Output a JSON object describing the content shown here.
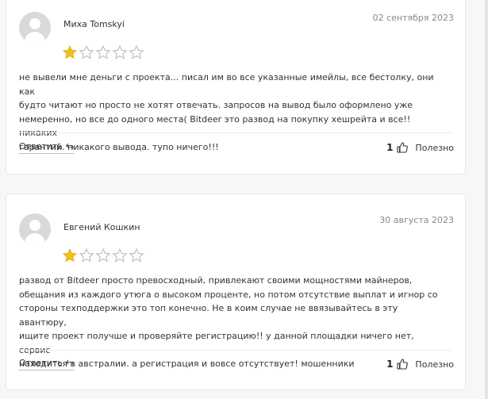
{
  "reviews": [
    {
      "author": "Миха Tomskyi",
      "date": "02 сентября 2023",
      "rating": 1,
      "max_rating": 5,
      "text_lines": [
        "не вывели мне деньги с проекта... писал им во все указанные имейлы, все бестолку, они как",
        "будто читают но просто не хотят отвечать. запросов на вывод было оформлено уже",
        "немеренно, но все до одного места( Bitdeer это развод на покупку хешрейта и все!! никаких",
        "гарантий. никакого вывода. тупо ничего!!!"
      ],
      "reply_label": "Ответить",
      "likes": "1",
      "useful_label": "Полезно"
    },
    {
      "author": "Евгений Кошкин",
      "date": "30 августа 2023",
      "rating": 1,
      "max_rating": 5,
      "text_lines": [
        "развод от Bitdeer просто превосходный, привлекают своими мощностями майнеров,",
        "обещания из каждого утюга о высоком проценте, но потом отсутствие выплат и игнор со",
        "стороны техподдержки это топ конечно. Не в коим случае не ввязывайтесь в эту авантюру,",
        "ищите проект получше и проверяйте регистрацию!! у данной площадки ничего нет, сервис",
        "находится в австралии. а регистрация и вовсе отсутствует! мошенники"
      ],
      "reply_label": "Ответить",
      "likes": "1",
      "useful_label": "Полезно"
    }
  ],
  "colors": {
    "star_filled": "#f2c01e",
    "star_outline": "#bbbbbb",
    "card_bg": "#ffffff",
    "page_bg": "#f7f7f7"
  },
  "icons": {
    "reply": "reply-arrow-icon",
    "like": "thumbs-up-icon",
    "avatar": "user-avatar-placeholder"
  }
}
